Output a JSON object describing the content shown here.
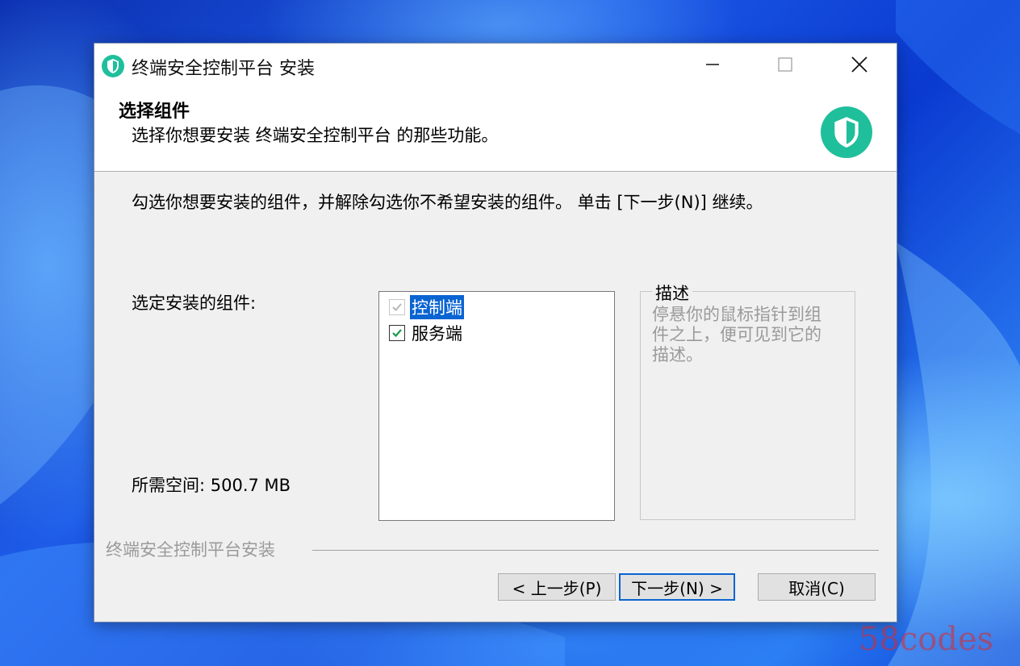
{
  "window": {
    "title": "终端安全控制平台 安装"
  },
  "header": {
    "title": "选择组件",
    "subtitle": "选择你想要安装 终端安全控制平台 的那些功能。"
  },
  "body": {
    "instruction": "勾选你想要安装的组件，并解除勾选你不希望安装的组件。 单击 [下一步(N)] 继续。",
    "select_label": "选定安装的组件:",
    "space_label": "所需空间: 500.7 MB"
  },
  "components": [
    {
      "label": "控制端",
      "checked": true,
      "disabled": true,
      "selected": true
    },
    {
      "label": "服务端",
      "checked": true,
      "disabled": false,
      "selected": false
    }
  ],
  "description": {
    "title": "描述",
    "text": "停悬你的鼠标指针到组件之上，便可见到它的描述。"
  },
  "branding": "终端安全控制平台安装",
  "buttons": {
    "back": "< 上一步(P)",
    "next": "下一步(N) >",
    "cancel": "取消(C)"
  },
  "watermark": "58codes",
  "icons": {
    "app": "shield-icon",
    "minimize": "minimize-icon",
    "maximize": "maximize-icon",
    "close": "close-icon"
  },
  "colors": {
    "accent": "#1fbf9c",
    "selection": "#0a64d2"
  }
}
